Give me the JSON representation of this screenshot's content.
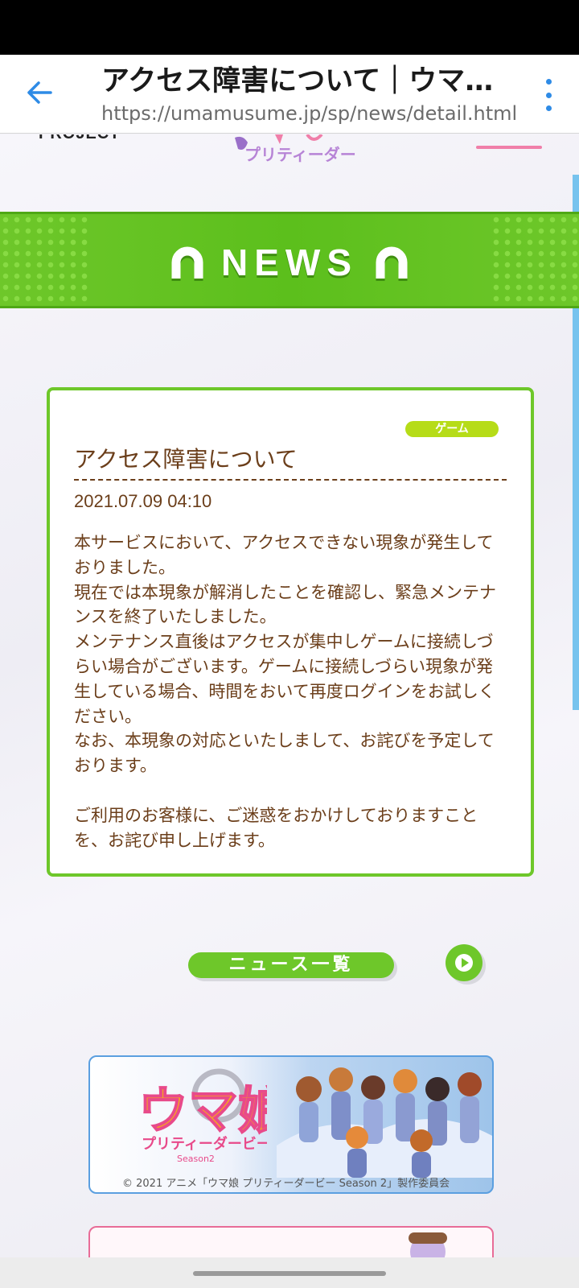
{
  "browser": {
    "tab_title": "アクセス障害について｜ウマ娘 プリティーダービー",
    "url": "https://umamusume.jp/sp/news/detail.html"
  },
  "page_header": {
    "project_text": "PROJECT",
    "logo_fragment_text": "プリティーダービー"
  },
  "news_banner": {
    "title": "NEWS"
  },
  "article": {
    "category": "ゲーム",
    "title": "アクセス障害について",
    "date": "2021.07.09 04:10",
    "body": "本サービスにおいて、アクセスできない現象が発生しておりました。\n現在では本現象が解消したことを確認し、緊急メンテナンスを終了いたしました。\nメンテナンス直後はアクセスが集中しゲームに接続しづらい場合がございます。ゲームに接続しづらい現象が発生している場合、時間をおいて再度ログインをお試しください。\nなお、本現象の対応といたしまして、お詫びを予定しております。\n\nご利用のお客様に、ご迷惑をおかけしておりますことを、お詫び申し上げます。"
  },
  "news_list_button": {
    "label": "ニュース一覧"
  },
  "promo_banner_1": {
    "logo_text": "ウマ娘",
    "logo_subtitle": "プリティーダービー",
    "season_text": "Season2",
    "caption": "© 2021 アニメ「ウマ娘 プリティーダービー Season 2」製作委員会"
  },
  "colors": {
    "accent_green": "#6ec72a",
    "link_blue": "#2e8be6",
    "text_brown": "#6b3e1a",
    "badge_lime": "#b6dc18",
    "pink": "#f07fa9"
  },
  "icons": {
    "back": "arrow-left-icon",
    "menu": "more-vertical-icon",
    "horseshoe": "horseshoe-icon",
    "play": "play-icon"
  }
}
